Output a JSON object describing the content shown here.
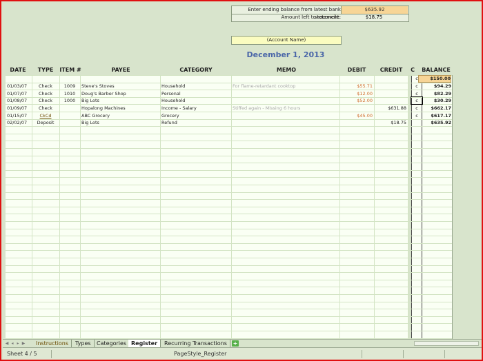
{
  "reconcile": {
    "ending_label": "Enter ending balance from latest bank statement:",
    "ending_value": "$635.92",
    "left_label": "Amount left to reconcile:",
    "left_value": "$18.75"
  },
  "account_name": "(Account Name)",
  "register_date": "December 1, 2013",
  "headers": {
    "date": "DATE",
    "type": "TYPE",
    "item": "ITEM #",
    "payee": "PAYEE",
    "category": "CATEGORY",
    "memo": "MEMO",
    "debit": "DEBIT",
    "credit": "CREDIT",
    "c": "C",
    "balance": "BALANCE"
  },
  "opening": {
    "c": "c",
    "balance": "$150.00"
  },
  "rows": [
    {
      "date": "01/03/07",
      "type": "Check",
      "item": "1009",
      "payee": "Steve's Stoves",
      "category": "Household",
      "memo": "For flame-retardant cooktop",
      "debit": "$55.71",
      "credit": "",
      "c": "c",
      "balance": "$94.29"
    },
    {
      "date": "01/07/07",
      "type": "Check",
      "item": "1010",
      "payee": "Doug's Barber Shop",
      "category": "Personal",
      "memo": "",
      "debit": "$12.00",
      "credit": "",
      "c": "c",
      "balance": "$82.29"
    },
    {
      "date": "01/08/07",
      "type": "Check",
      "item": "1000",
      "payee": "Big Lots",
      "category": "Household",
      "memo": "",
      "debit": "$52.00",
      "credit": "",
      "c": "c",
      "balance": "$30.29"
    },
    {
      "date": "01/09/07",
      "type": "Check",
      "item": "",
      "payee": "Hopalong Machines",
      "category": "Income - Salary",
      "memo": "Stiffed again - Missing 6 hours",
      "debit": "",
      "credit": "$631.88",
      "c": "c",
      "balance": "$662.17"
    },
    {
      "date": "01/15/07",
      "type": "CkCd",
      "item": "",
      "payee": "ABC Grocery",
      "category": "Grocery",
      "memo": "",
      "debit": "$45.00",
      "credit": "",
      "c": "c",
      "balance": "$617.17"
    },
    {
      "date": "02/02/07",
      "type": "Deposit",
      "item": "",
      "payee": "Big Lots",
      "category": "Refund",
      "memo": "",
      "debit": "",
      "credit": "$18.75",
      "c": "",
      "balance": "$635.92"
    }
  ],
  "tabs": [
    "Instructions",
    "Types",
    "Categories",
    "Register",
    "Recurring Transactions"
  ],
  "active_tab": "Register",
  "status": {
    "sheet": "Sheet 4 / 5",
    "page_style": "PageStyle_Register"
  },
  "icons": {
    "add_sheet": "plus-icon",
    "nav": [
      "first-sheet-icon",
      "prev-sheet-icon",
      "next-sheet-icon",
      "last-sheet-icon"
    ]
  },
  "colors": {
    "frame": "#e01010",
    "header_bg": "#d8e4cc",
    "ending_balance_fill": "#f7d596",
    "account_fill": "#fafcc0",
    "title": "#4a66a8",
    "debit": "#d06a2a",
    "add_tab": "#57b04a"
  }
}
